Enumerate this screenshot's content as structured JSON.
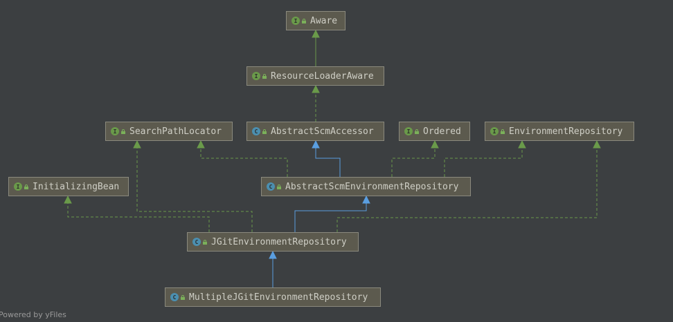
{
  "diagram": {
    "nodes": [
      {
        "id": "aware",
        "label": "Aware",
        "kind": "I"
      },
      {
        "id": "rla",
        "label": "ResourceLoaderAware",
        "kind": "I"
      },
      {
        "id": "spl",
        "label": "SearchPathLocator",
        "kind": "I"
      },
      {
        "id": "asa",
        "label": "AbstractScmAccessor",
        "kind": "C"
      },
      {
        "id": "ord",
        "label": "Ordered",
        "kind": "I"
      },
      {
        "id": "env",
        "label": "EnvironmentRepository",
        "kind": "I"
      },
      {
        "id": "ib",
        "label": "InitializingBean",
        "kind": "I"
      },
      {
        "id": "aser",
        "label": "AbstractScmEnvironmentRepository",
        "kind": "C"
      },
      {
        "id": "jger",
        "label": "JGitEnvironmentRepository",
        "kind": "C"
      },
      {
        "id": "mjger",
        "label": "MultipleJGitEnvironmentRepository",
        "kind": "C"
      }
    ],
    "edges": [
      {
        "from": "rla",
        "to": "aware",
        "type": "extends-interface"
      },
      {
        "from": "asa",
        "to": "rla",
        "type": "implements"
      },
      {
        "from": "aser",
        "to": "asa",
        "type": "extends"
      },
      {
        "from": "aser",
        "to": "spl",
        "type": "implements"
      },
      {
        "from": "aser",
        "to": "ord",
        "type": "implements"
      },
      {
        "from": "aser",
        "to": "env",
        "type": "implements"
      },
      {
        "from": "jger",
        "to": "aser",
        "type": "extends"
      },
      {
        "from": "jger",
        "to": "ib",
        "type": "implements"
      },
      {
        "from": "jger",
        "to": "spl",
        "type": "implements"
      },
      {
        "from": "jger",
        "to": "env",
        "type": "implements"
      },
      {
        "from": "mjger",
        "to": "jger",
        "type": "extends"
      }
    ],
    "colors": {
      "background": "#3c3f41",
      "implements": "#6a9a4a",
      "extends": "#5a9ee0",
      "node_fill": "#5c5a4e",
      "node_border": "#8b8a7e"
    }
  },
  "footer": "Powered by yFiles"
}
